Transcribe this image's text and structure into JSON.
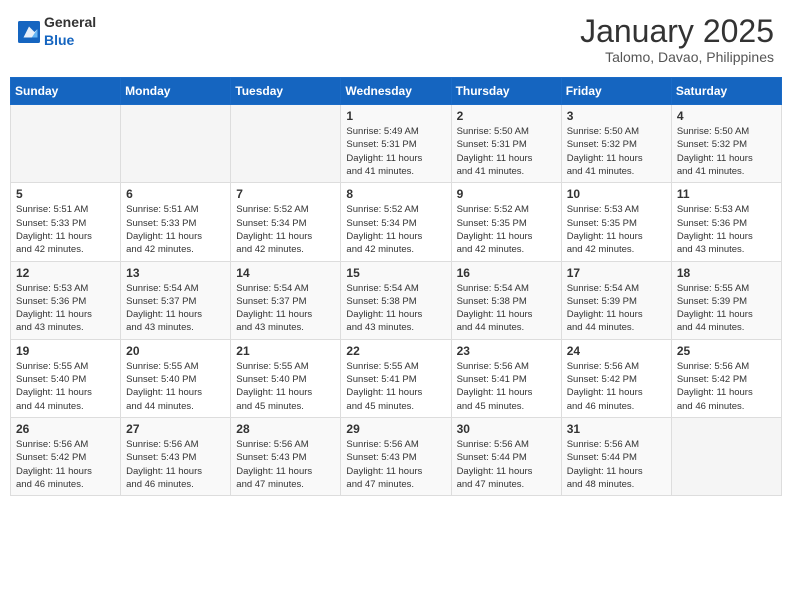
{
  "header": {
    "logo_general": "General",
    "logo_blue": "Blue",
    "title": "January 2025",
    "subtitle": "Talomo, Davao, Philippines"
  },
  "weekdays": [
    "Sunday",
    "Monday",
    "Tuesday",
    "Wednesday",
    "Thursday",
    "Friday",
    "Saturday"
  ],
  "weeks": [
    [
      {
        "day": "",
        "info": ""
      },
      {
        "day": "",
        "info": ""
      },
      {
        "day": "",
        "info": ""
      },
      {
        "day": "1",
        "info": "Sunrise: 5:49 AM\nSunset: 5:31 PM\nDaylight: 11 hours\nand 41 minutes."
      },
      {
        "day": "2",
        "info": "Sunrise: 5:50 AM\nSunset: 5:31 PM\nDaylight: 11 hours\nand 41 minutes."
      },
      {
        "day": "3",
        "info": "Sunrise: 5:50 AM\nSunset: 5:32 PM\nDaylight: 11 hours\nand 41 minutes."
      },
      {
        "day": "4",
        "info": "Sunrise: 5:50 AM\nSunset: 5:32 PM\nDaylight: 11 hours\nand 41 minutes."
      }
    ],
    [
      {
        "day": "5",
        "info": "Sunrise: 5:51 AM\nSunset: 5:33 PM\nDaylight: 11 hours\nand 42 minutes."
      },
      {
        "day": "6",
        "info": "Sunrise: 5:51 AM\nSunset: 5:33 PM\nDaylight: 11 hours\nand 42 minutes."
      },
      {
        "day": "7",
        "info": "Sunrise: 5:52 AM\nSunset: 5:34 PM\nDaylight: 11 hours\nand 42 minutes."
      },
      {
        "day": "8",
        "info": "Sunrise: 5:52 AM\nSunset: 5:34 PM\nDaylight: 11 hours\nand 42 minutes."
      },
      {
        "day": "9",
        "info": "Sunrise: 5:52 AM\nSunset: 5:35 PM\nDaylight: 11 hours\nand 42 minutes."
      },
      {
        "day": "10",
        "info": "Sunrise: 5:53 AM\nSunset: 5:35 PM\nDaylight: 11 hours\nand 42 minutes."
      },
      {
        "day": "11",
        "info": "Sunrise: 5:53 AM\nSunset: 5:36 PM\nDaylight: 11 hours\nand 43 minutes."
      }
    ],
    [
      {
        "day": "12",
        "info": "Sunrise: 5:53 AM\nSunset: 5:36 PM\nDaylight: 11 hours\nand 43 minutes."
      },
      {
        "day": "13",
        "info": "Sunrise: 5:54 AM\nSunset: 5:37 PM\nDaylight: 11 hours\nand 43 minutes."
      },
      {
        "day": "14",
        "info": "Sunrise: 5:54 AM\nSunset: 5:37 PM\nDaylight: 11 hours\nand 43 minutes."
      },
      {
        "day": "15",
        "info": "Sunrise: 5:54 AM\nSunset: 5:38 PM\nDaylight: 11 hours\nand 43 minutes."
      },
      {
        "day": "16",
        "info": "Sunrise: 5:54 AM\nSunset: 5:38 PM\nDaylight: 11 hours\nand 44 minutes."
      },
      {
        "day": "17",
        "info": "Sunrise: 5:54 AM\nSunset: 5:39 PM\nDaylight: 11 hours\nand 44 minutes."
      },
      {
        "day": "18",
        "info": "Sunrise: 5:55 AM\nSunset: 5:39 PM\nDaylight: 11 hours\nand 44 minutes."
      }
    ],
    [
      {
        "day": "19",
        "info": "Sunrise: 5:55 AM\nSunset: 5:40 PM\nDaylight: 11 hours\nand 44 minutes."
      },
      {
        "day": "20",
        "info": "Sunrise: 5:55 AM\nSunset: 5:40 PM\nDaylight: 11 hours\nand 44 minutes."
      },
      {
        "day": "21",
        "info": "Sunrise: 5:55 AM\nSunset: 5:40 PM\nDaylight: 11 hours\nand 45 minutes."
      },
      {
        "day": "22",
        "info": "Sunrise: 5:55 AM\nSunset: 5:41 PM\nDaylight: 11 hours\nand 45 minutes."
      },
      {
        "day": "23",
        "info": "Sunrise: 5:56 AM\nSunset: 5:41 PM\nDaylight: 11 hours\nand 45 minutes."
      },
      {
        "day": "24",
        "info": "Sunrise: 5:56 AM\nSunset: 5:42 PM\nDaylight: 11 hours\nand 46 minutes."
      },
      {
        "day": "25",
        "info": "Sunrise: 5:56 AM\nSunset: 5:42 PM\nDaylight: 11 hours\nand 46 minutes."
      }
    ],
    [
      {
        "day": "26",
        "info": "Sunrise: 5:56 AM\nSunset: 5:42 PM\nDaylight: 11 hours\nand 46 minutes."
      },
      {
        "day": "27",
        "info": "Sunrise: 5:56 AM\nSunset: 5:43 PM\nDaylight: 11 hours\nand 46 minutes."
      },
      {
        "day": "28",
        "info": "Sunrise: 5:56 AM\nSunset: 5:43 PM\nDaylight: 11 hours\nand 47 minutes."
      },
      {
        "day": "29",
        "info": "Sunrise: 5:56 AM\nSunset: 5:43 PM\nDaylight: 11 hours\nand 47 minutes."
      },
      {
        "day": "30",
        "info": "Sunrise: 5:56 AM\nSunset: 5:44 PM\nDaylight: 11 hours\nand 47 minutes."
      },
      {
        "day": "31",
        "info": "Sunrise: 5:56 AM\nSunset: 5:44 PM\nDaylight: 11 hours\nand 48 minutes."
      },
      {
        "day": "",
        "info": ""
      }
    ]
  ]
}
